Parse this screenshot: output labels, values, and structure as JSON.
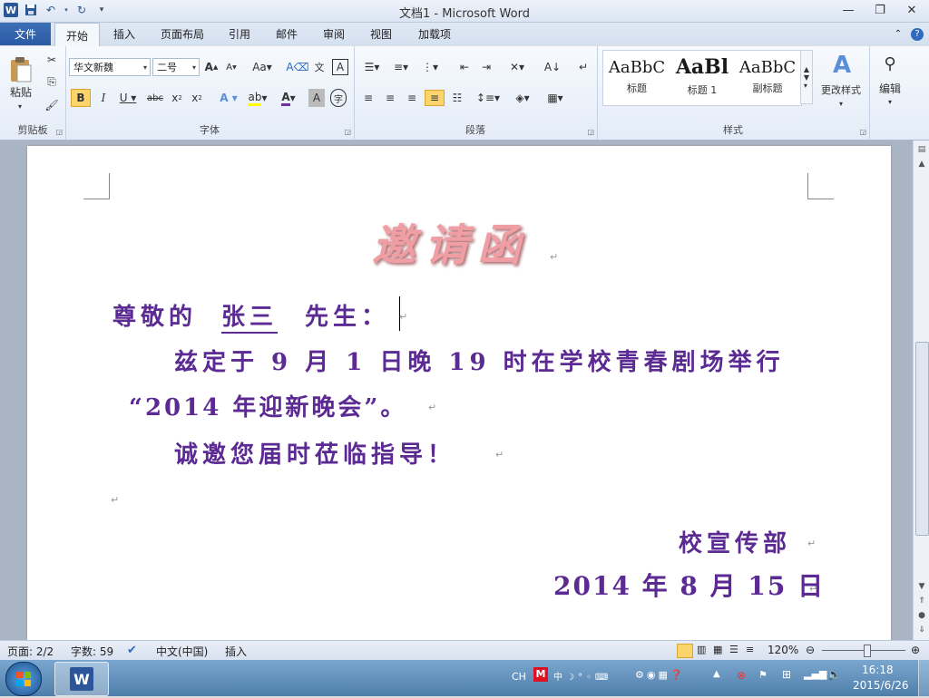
{
  "window": {
    "title": "文档1 - Microsoft Word"
  },
  "tabs": [
    "文件",
    "开始",
    "插入",
    "页面布局",
    "引用",
    "邮件",
    "审阅",
    "视图",
    "加载项"
  ],
  "ribbon": {
    "clipboard": {
      "paste_label": "粘贴",
      "group_label": "剪贴板"
    },
    "font": {
      "font_name": "华文新魏",
      "font_size": "二号",
      "group_label": "字体"
    },
    "paragraph": {
      "group_label": "段落"
    },
    "styles": {
      "group_label": "样式",
      "items": [
        {
          "sample": "AaBbC",
          "name": "标题"
        },
        {
          "sample": "AaBl",
          "name": "标题 1"
        },
        {
          "sample": "AaBbC",
          "name": "副标题"
        }
      ],
      "change_styles_label": "更改样式"
    },
    "editing": {
      "label": "编辑"
    }
  },
  "document": {
    "heading": "邀请函",
    "salutation_prefix": "尊敬的",
    "recipient": "张三",
    "salutation_suffix": "先生：",
    "body_line1": "兹定于 9 月 1 日晚 19 时在学校青春剧场举行",
    "body_line2": "“2014 年迎新晚会”。",
    "body_line3": "诚邀您届时莅临指导！",
    "signature_dept": "校宣传部",
    "signature_date": "2014 年 8 月 15 日",
    "para_mark": "↵"
  },
  "statusbar": {
    "page": "页面: 2/2",
    "words": "字数: 59",
    "language": "中文(中国)",
    "mode": "插入",
    "zoom": "120%"
  },
  "taskbar": {
    "ime": "CH",
    "time": "16:18",
    "date": "2015/6/26"
  },
  "colors": {
    "text_purple": "#5b2a92",
    "heading_pink": "#e79aa0",
    "file_tab": "#2a5aa3"
  }
}
